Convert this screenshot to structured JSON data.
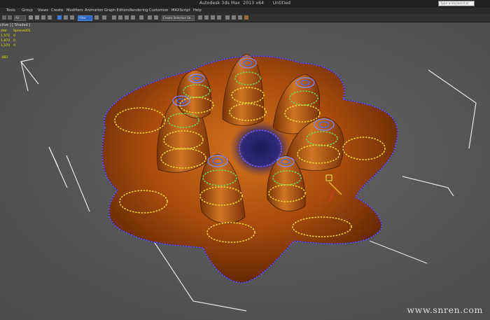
{
  "window": {
    "title": "Autodesk 3ds Max  2013 x64      Untitled",
    "search_placeholder": "Type a keyword or phrase"
  },
  "menu": {
    "items": [
      "Tools",
      "Group",
      "Views",
      "Create",
      "Modifiers",
      "Animation",
      "Graph Editors",
      "Rendering",
      "Customize",
      "MAXScript",
      "Help"
    ]
  },
  "toolbar": {
    "selection_filter": "All",
    "reference_coord": "View",
    "named_selection": "Create Selection Se..."
  },
  "viewport": {
    "label": "ctive ] [ Shaded ]",
    "stats": {
      "col1_header": "otal",
      "col2_header": "Sphere001",
      "rows": [
        {
          "a": "1,572",
          "b": "0"
        },
        {
          "a": "1,874",
          "b": "0"
        },
        {
          "a": "1,570",
          "b": "0"
        }
      ],
      "fps": ".083"
    }
  },
  "watermark": "www.snren.com",
  "colors": {
    "model": "#b5540d",
    "viewport_bg": "#5a5a5a",
    "gizmo": "#e8e8e8",
    "verts_ring": "#3b6cff"
  },
  "icons": [
    "new-file-icon",
    "open-icon",
    "save-icon",
    "undo-icon",
    "redo-icon",
    "select-object-icon",
    "select-region-icon",
    "move-icon",
    "rotate-icon",
    "scale-icon",
    "snap-icon",
    "mirror-icon",
    "align-icon",
    "render-icon"
  ]
}
